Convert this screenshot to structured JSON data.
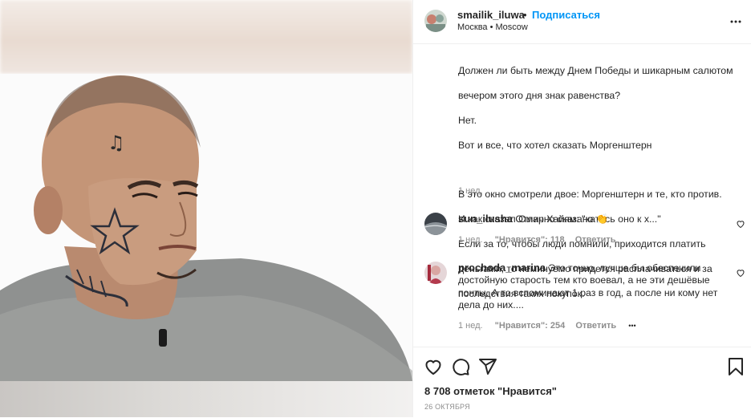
{
  "post": {
    "username": "smailik_iluwa",
    "dot": "•",
    "follow_label": "Подписаться",
    "location": "Москва • Moscow",
    "caption_lines": [
      "Должен ли быть между Днем Победы и шикарным салютом",
      "вечером этого дня знак равенства?",
      "Нет.",
      "Вот и все, что хотел сказать Моргенштерн",
      "",
      "В это окно смотрели двое: Моргенштерн и те, кто против.",
      "И как сказал Омар Хайям: \"катись оно к х...\"",
      "Если за то, чтобы люди помнили, приходится платить",
      "деньгами, то неминуемо придется расплачиваться и за",
      "последствия таких покупок."
    ],
    "caption_time": "1 нед.",
    "likes": "8 708 отметок \"Нравится\"",
    "date": "26 ОКТЯБРЯ"
  },
  "comments": [
    {
      "username": "sun_ilusha",
      "text": "Отлично сказано 👏",
      "time": "1 нед.",
      "likes": "\"Нравится\": 118",
      "reply": "Ответить"
    },
    {
      "username": "prochoda_marina",
      "text": "Это точно, лучше бы обеспечили достойную старость тем кто воевал, а не эти дешёвые понты. А то вспоминают 1 раз в год, а после ни кому нет дела до них....",
      "time": "1 нед.",
      "likes": "\"Нравится\": 254",
      "reply": "Ответить",
      "more": "•••"
    }
  ],
  "icons": {
    "options": "more-options-icon",
    "like": "heart-icon",
    "comment": "comment-icon",
    "share": "share-icon",
    "save": "bookmark-icon"
  },
  "colors": {
    "link": "#0095f6",
    "text": "#262626",
    "muted": "#8e8e8e",
    "border": "#efefef"
  }
}
